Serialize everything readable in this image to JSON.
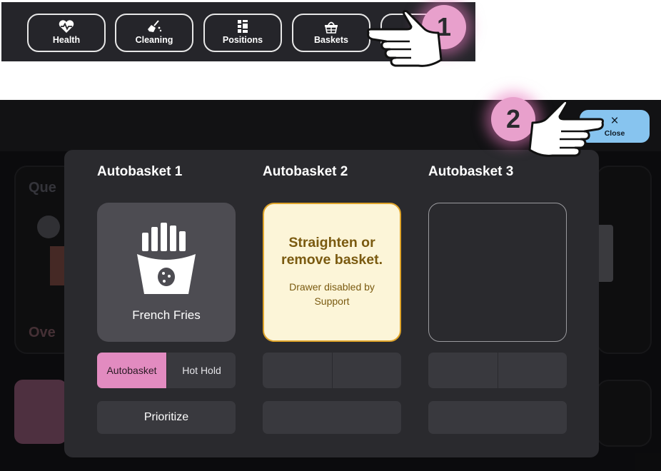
{
  "toolbar": {
    "buttons": [
      {
        "label": "Health",
        "icon": "heart-icon"
      },
      {
        "label": "Cleaning",
        "icon": "broom-icon"
      },
      {
        "label": "Positions",
        "icon": "grid-icon"
      },
      {
        "label": "Baskets",
        "icon": "basket-icon"
      }
    ]
  },
  "steps": {
    "one": "1",
    "two": "2"
  },
  "header": {
    "close_icon": "×",
    "close_label": "Close"
  },
  "background": {
    "left_text_1": "Que",
    "left_text_2": "Ove"
  },
  "modal": {
    "columns": [
      {
        "title": "Autobasket 1",
        "tile_label": "French Fries",
        "seg_left": "Autobasket",
        "seg_right": "Hot Hold",
        "action": "Prioritize"
      },
      {
        "title": "Autobasket 2",
        "warning_title": "Straighten or remove basket.",
        "warning_sub": "Drawer disabled by Support"
      },
      {
        "title": "Autobasket 3"
      }
    ]
  },
  "colors": {
    "accent_pink": "#e28bc0",
    "warning_bg": "#fcf5d8",
    "warning_border": "#dfa42a",
    "close_button": "#87c4ef"
  }
}
